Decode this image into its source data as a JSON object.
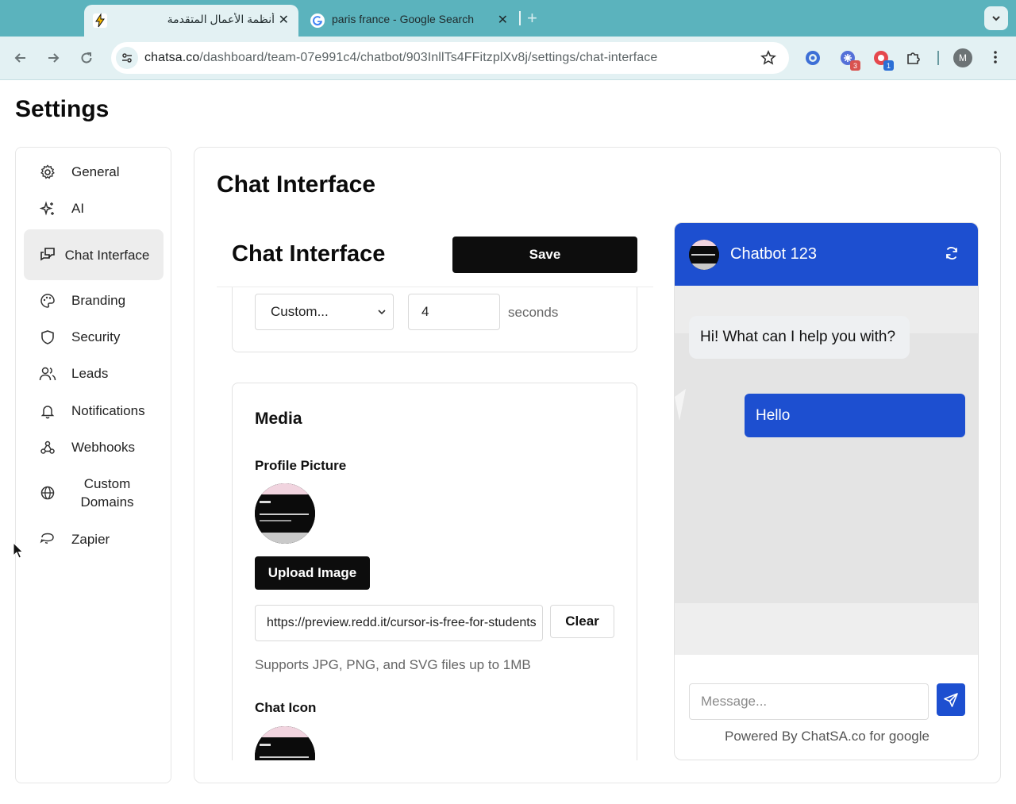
{
  "browser": {
    "tabs": [
      {
        "title": "أنظمة الأعمال المتقدمة",
        "icon": "bolt-icon",
        "active": true
      },
      {
        "title": "paris france - Google Search",
        "icon": "google-icon",
        "active": false
      }
    ],
    "close_glyph": "✕",
    "new_tab_glyph": "+",
    "url_host": "chatsa.co",
    "url_path": "/dashboard/team-07e991c4/chatbot/903InllTs4FFitzplXv8j/settings/chat-interface",
    "extension_badges": [
      "3",
      "1"
    ],
    "profile_initial": "M",
    "colors": {
      "tabbar": "#5bb3bd",
      "toolbar": "#e3f1f3"
    }
  },
  "page": {
    "title": "Settings"
  },
  "sidebar": {
    "items": [
      {
        "label": "General",
        "icon": "gear-icon"
      },
      {
        "label": "AI",
        "icon": "sparkles-icon"
      },
      {
        "label": "Chat Interface",
        "icon": "chat-bubbles-icon",
        "active": true
      },
      {
        "label": "Branding",
        "icon": "palette-icon"
      },
      {
        "label": "Security",
        "icon": "shield-icon"
      },
      {
        "label": "Leads",
        "icon": "users-icon"
      },
      {
        "label": "Notifications",
        "icon": "bell-icon"
      },
      {
        "label": "Webhooks",
        "icon": "webhook-icon"
      },
      {
        "label": "Custom Domains",
        "icon": "globe-icon"
      },
      {
        "label": "Zapier",
        "icon": "zapier-icon"
      }
    ]
  },
  "main": {
    "title": "Chat Interface",
    "form": {
      "title": "Chat Interface",
      "save_label": "Save",
      "delay_select": "Custom...",
      "delay_value": "4",
      "delay_unit": "seconds",
      "media": {
        "title": "Media",
        "profile_picture_label": "Profile Picture",
        "upload_label": "Upload Image",
        "image_url": "https://preview.redd.it/cursor-is-free-for-students",
        "clear_label": "Clear",
        "hint": "Supports JPG, PNG, and SVG files up to 1MB",
        "chat_icon_label": "Chat Icon"
      }
    },
    "preview": {
      "bot_name": "Chatbot 123",
      "bot_message": "Hi! What can I help you with?",
      "user_message": "Hello",
      "message_placeholder": "Message...",
      "powered_by": "Powered By ChatSA.co for google",
      "accent": "#1d4fd0"
    }
  }
}
